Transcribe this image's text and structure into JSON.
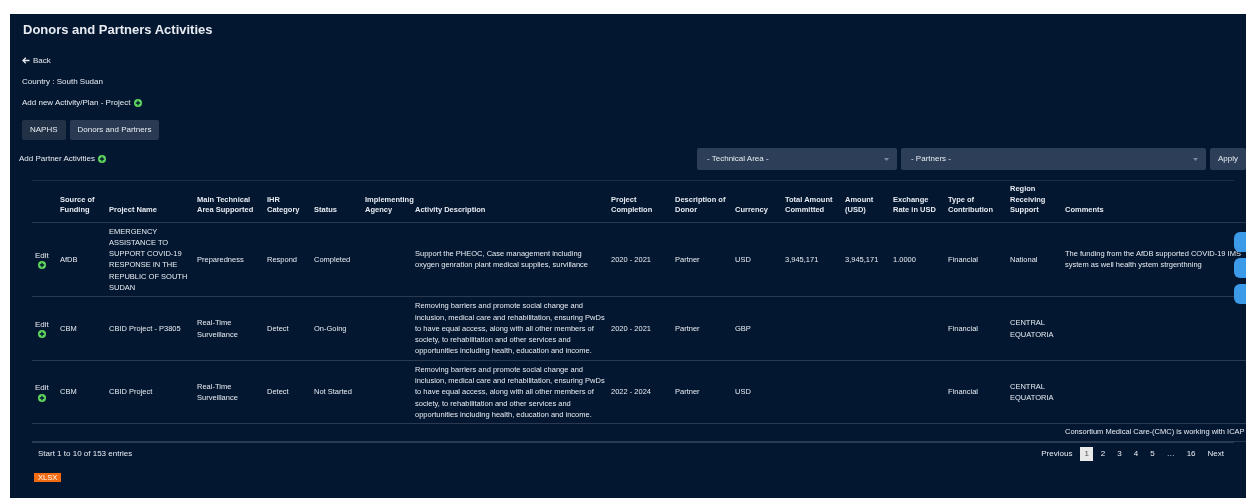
{
  "page_title": "Donors and Partners Activities",
  "back_link": "Back",
  "country_label": "Country : South Sudan",
  "add_activity_link": "Add new Activity/Plan - Project",
  "tabs": [
    {
      "label": "NAPHS",
      "selected": false
    },
    {
      "label": "Donors and Partners",
      "selected": true
    }
  ],
  "add_partner_link": "Add Partner Activities",
  "filters": [
    {
      "value": "- Technical Area -"
    },
    {
      "value": "- Partners -"
    }
  ],
  "apply_button": "Apply",
  "table": {
    "columns": [
      "Source of Funding",
      "Project Name",
      "Main Technical Area Supported",
      "IHR Category",
      "Status",
      "Implementing Agency",
      "Activity Description",
      "Project Completion",
      "Description of Donor",
      "Currency",
      "Total Amount Committed",
      "Amount (USD)",
      "Exchange Rate in USD",
      "Type of Contribution",
      "Region Receiving Support",
      "Comments"
    ],
    "rows": [
      {
        "edit": "Edit",
        "cells": [
          "AfDB",
          "EMERGENCY ASSISTANCE TO SUPPORT COVID-19 RESPONSE IN THE REPUBLIC OF SOUTH SUDAN",
          "Preparedness",
          "Respond",
          "Completed",
          "",
          "Support the PHEOC, Case management including oxygen genration plant medical supplies, survillance",
          "2020 - 2021",
          "Partner",
          "USD",
          "3,945,171",
          "3,945,171",
          "1.0000",
          "Financial",
          "National",
          "The funding from the AfDB supported COVID-19 IMS system as well health ystem strgenthning"
        ]
      },
      {
        "edit": "Edit",
        "cells": [
          "CBM",
          "CBID Project - P3805",
          "Real-Time Surveillance",
          "Detect",
          "On-Going",
          "",
          "Removing barriers and promote social change and inclusion, medical care and rehabilitation, ensuring PwDs to have equal access, along with all other members of society, to rehabilitation and other services and opportunities including health, education and income.",
          "2020 - 2021",
          "Partner",
          "GBP",
          "",
          "",
          "",
          "Financial",
          "CENTRAL EQUATORIA",
          ""
        ]
      },
      {
        "edit": "Edit",
        "cells": [
          "CBM",
          "CBID Project",
          "Real-Time Surveillance",
          "Detect",
          "Not Started",
          "",
          "Removing barriers and promote social change and inclusion, medical care and rehabilitation, ensuring PwDs to have equal access, along with all other members of society, to rehabilitation and other services and opportunities including health, education and income.",
          "2022 - 2024",
          "Partner",
          "USD",
          "",
          "",
          "",
          "Financial",
          "CENTRAL EQUATORIA",
          ""
        ]
      }
    ],
    "partial_row_comment": "Consortium Medical Care-(CMC) is working with ICAP"
  },
  "entries_info": "Start 1 to 10 of 153 entries",
  "pagination": {
    "previous": "Previous",
    "pages": [
      {
        "label": "1",
        "selected": true
      },
      {
        "label": "2",
        "selected": false
      },
      {
        "label": "3",
        "selected": false
      },
      {
        "label": "4",
        "selected": false
      },
      {
        "label": "5",
        "selected": false
      },
      {
        "label": "…",
        "selected": false
      },
      {
        "label": "16",
        "selected": false
      }
    ],
    "next": "Next"
  },
  "export_button": "XLSX"
}
